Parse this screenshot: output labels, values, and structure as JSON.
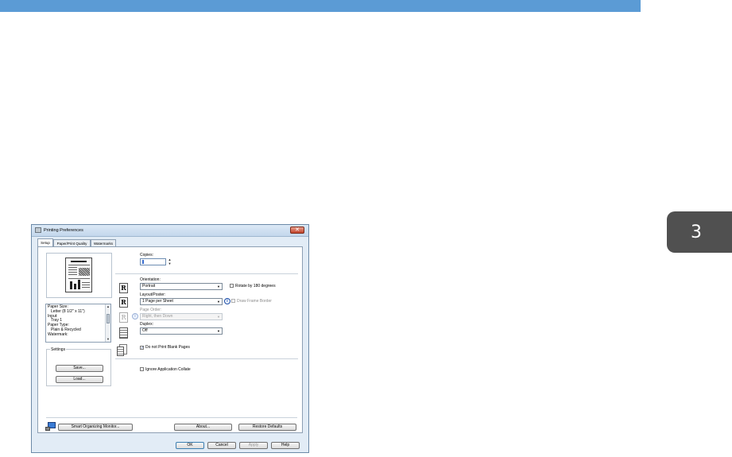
{
  "chapter": {
    "number": "3"
  },
  "window": {
    "title": "Printing Preferences",
    "close_glyph": "✕",
    "tabs": [
      "Setup",
      "Paper/Print Quality",
      "Watermarks"
    ]
  },
  "summary": {
    "lines": [
      {
        "text": "Paper Size:",
        "indent": false
      },
      {
        "text": "Letter (8 1/2\" x 11\")",
        "indent": true
      },
      {
        "text": "Input:",
        "indent": false
      },
      {
        "text": "Tray 1",
        "indent": true
      },
      {
        "text": "Paper Type:",
        "indent": false
      },
      {
        "text": "Plain & Recycled",
        "indent": true
      },
      {
        "text": "Watermark:",
        "indent": false
      }
    ]
  },
  "settings": {
    "label": "Settings",
    "save": "Save...",
    "load": "Load..."
  },
  "copies": {
    "label": "Copies:",
    "value": "1"
  },
  "orientation": {
    "label": "Orientation:",
    "value": "Portrait",
    "rotate_label": "Rotate by 180 degrees",
    "rotate_checked": false
  },
  "layout": {
    "label": "Layout/Poster:",
    "value": "1 Page per Sheet",
    "frame_label": "Draw Frame Border",
    "frame_checked": false
  },
  "page_order": {
    "label": "Page Order:",
    "value": "Right, then Down"
  },
  "duplex": {
    "label": "Duplex:",
    "value": "Off"
  },
  "blank_pages": {
    "label": "Do not Print Blank Pages",
    "checked": true
  },
  "collate": {
    "label": "Ignore Application Collate",
    "checked": false
  },
  "icons": {
    "orientation_letter": "R",
    "check_mark": "✓",
    "info": "i",
    "down_arrow": "▼",
    "up_arrow": "▲"
  },
  "buttons": {
    "monitor": "Smart Organizing Monitor...",
    "about": "About...",
    "restore": "Restore Defaults",
    "ok": "OK",
    "cancel": "Cancel",
    "apply": "Apply",
    "help": "Help"
  }
}
